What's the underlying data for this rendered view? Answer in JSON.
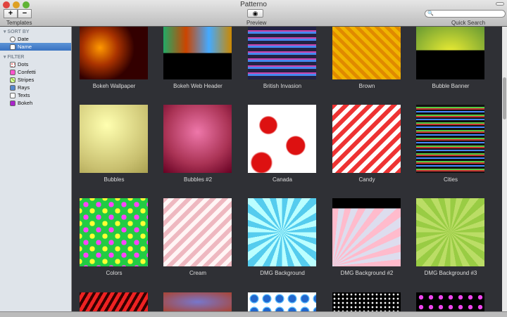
{
  "window": {
    "title": "Patterno"
  },
  "toolbar": {
    "add": "+",
    "remove": "−",
    "templates_label": "Templates",
    "preview_label": "Preview",
    "search_label": "Quick Search",
    "search_value": ""
  },
  "sidebar": {
    "sort_header": "SORT BY",
    "sort_items": [
      {
        "label": "Date",
        "selected": false
      },
      {
        "label": "Name",
        "selected": true
      }
    ],
    "filter_header": "FILTER",
    "filter_items": [
      {
        "label": "Dots"
      },
      {
        "label": "Confetti"
      },
      {
        "label": "Stripes"
      },
      {
        "label": "Rays"
      },
      {
        "label": "Texts"
      },
      {
        "label": "Bokeh"
      }
    ]
  },
  "templates": [
    {
      "name": "Bokeh Wallpaper"
    },
    {
      "name": "Bokeh Web Header"
    },
    {
      "name": "British Invasion"
    },
    {
      "name": "Brown"
    },
    {
      "name": "Bubble Banner"
    },
    {
      "name": "Bubbles"
    },
    {
      "name": "Bubbles #2"
    },
    {
      "name": "Canada"
    },
    {
      "name": "Candy"
    },
    {
      "name": "Cities"
    },
    {
      "name": "Colors"
    },
    {
      "name": "Cream"
    },
    {
      "name": "DMG Background"
    },
    {
      "name": "DMG Background #2"
    },
    {
      "name": "DMG Background #3"
    }
  ],
  "colors": {
    "accent": "#3a73c2",
    "content_bg": "#2f3035"
  }
}
